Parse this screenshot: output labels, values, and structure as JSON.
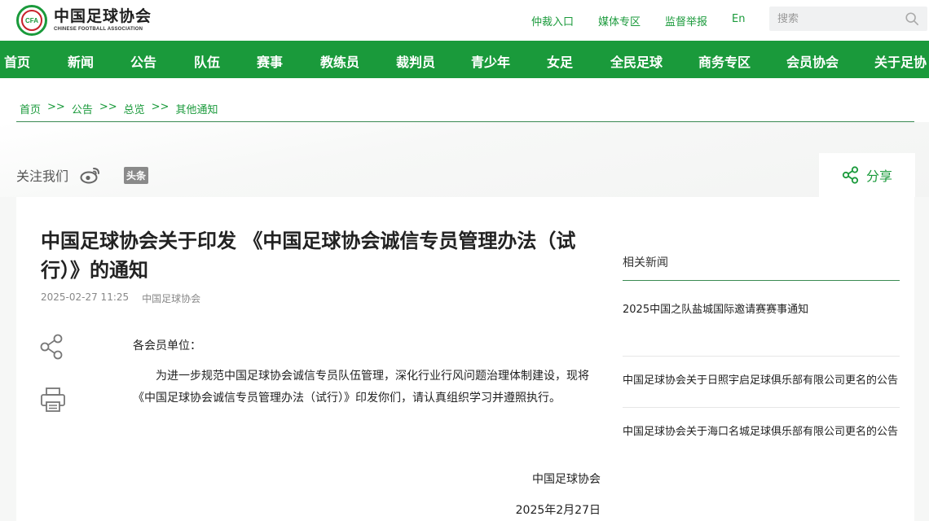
{
  "logo": {
    "cn": "中国足球协会",
    "en": "CHINESE FOOTBALL ASSOCIATION",
    "emblem_text": "CFA"
  },
  "top_links": [
    "仲裁入口",
    "媒体专区",
    "监督举报",
    "En"
  ],
  "search": {
    "placeholder": "搜索"
  },
  "nav": [
    "首页",
    "新闻",
    "公告",
    "队伍",
    "赛事",
    "教练员",
    "裁判员",
    "青少年",
    "女足",
    "全民足球",
    "商务专区",
    "会员协会",
    "关于足协"
  ],
  "breadcrumb": {
    "items": [
      "首页",
      "公告",
      "总览",
      "其他通知"
    ],
    "sep": ">>"
  },
  "follow": {
    "label": "关注我们",
    "toutiao": "头条"
  },
  "share": {
    "label": "分享"
  },
  "article": {
    "title": "中国足球协会关于印发 《中国足球协会诚信专员管理办法（试行）》的通知",
    "date": "2025-02-27 11:25",
    "source": "中国足球协会",
    "salutation": "各会员单位：",
    "paragraph": "为进一步规范中国足球协会诚信专员队伍管理，深化行业行风问题治理体制建设，现将《中国足球协会诚信专员管理办法（试行）》印发你们，请认真组织学习并遵照执行。",
    "sign_org": "中国足球协会",
    "sign_date": "2025年2月27日"
  },
  "related": {
    "title": "相关新闻",
    "items": [
      "2025中国之队盐城国际邀请赛赛事通知",
      "中国足球协会关于日照宇启足球俱乐部有限公司更名的公告",
      "中国足球协会关于海口名城足球俱乐部有限公司更名的公告"
    ]
  },
  "colors": {
    "brand_green": "#1a9a3b",
    "accent_red": "#c8202a"
  }
}
